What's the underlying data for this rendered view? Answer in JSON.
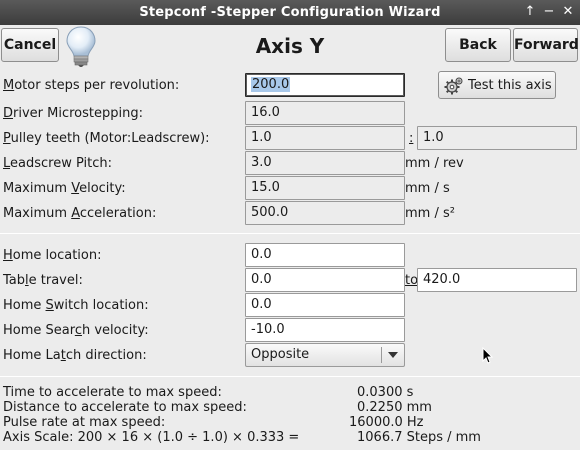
{
  "window": {
    "title": "Stepconf -Stepper Configuration Wizard",
    "controls": [
      "↑",
      "−",
      "✕"
    ]
  },
  "toolbar": {
    "cancel_label": "Cancel",
    "heading": "Axis Y",
    "back_label": "Back",
    "forward_label": "Forward"
  },
  "test_axis_label": "Test this axis",
  "fields": {
    "motor_steps": {
      "label_u": "M",
      "label_rest": "otor steps per revolution:",
      "value": "200.0"
    },
    "microstepping": {
      "label_u": "D",
      "label_rest": "river Microstepping:",
      "value": "16.0"
    },
    "pulley": {
      "label_u": "P",
      "label_rest": "ulley teeth (Motor:Leadscrew):",
      "value_a": "1.0",
      "sep": ":",
      "value_b": "1.0"
    },
    "pitch": {
      "label_u": "L",
      "label_rest": "eadscrew Pitch:",
      "value": "3.0",
      "unit": "mm / rev"
    },
    "max_velocity": {
      "label_pre": "Maximum ",
      "label_u": "V",
      "label_rest": "elocity:",
      "value": "15.0",
      "unit": "mm / s"
    },
    "max_accel": {
      "label_pre": "Maximum ",
      "label_u": "A",
      "label_rest": "cceleration:",
      "value": "500.0",
      "unit": "mm / s²"
    },
    "home_location": {
      "label_u": "H",
      "label_rest": "ome location:",
      "value": "0.0"
    },
    "table_travel": {
      "label_pre": "Tab",
      "label_u": "l",
      "label_rest": "e travel:",
      "value_a": "0.0",
      "to": "to",
      "value_b": "420.0"
    },
    "home_switch": {
      "label_pre": "Home ",
      "label_u": "S",
      "label_rest": "witch location:",
      "value": "0.0"
    },
    "home_search": {
      "label_pre": "Home Sear",
      "label_u": "c",
      "label_rest": "h velocity:",
      "value": "-10.0"
    },
    "home_latch": {
      "label_pre": "Home La",
      "label_u": "t",
      "label_rest": "ch direction:",
      "value": "Opposite"
    }
  },
  "info": {
    "accel_time_label": "Time to accelerate to max speed:",
    "accel_time_value": "0.0300 s",
    "accel_dist_label": "Distance to accelerate to max speed:",
    "accel_dist_value": "0.2250 mm",
    "pulse_rate_label": "Pulse rate at max speed:",
    "pulse_rate_value": "16000.0 Hz",
    "axis_scale_label": "Axis Scale: 200 × 16 × (1.0 ÷ 1.0) × 0.333 =",
    "axis_scale_value": "1066.7 Steps / mm"
  }
}
